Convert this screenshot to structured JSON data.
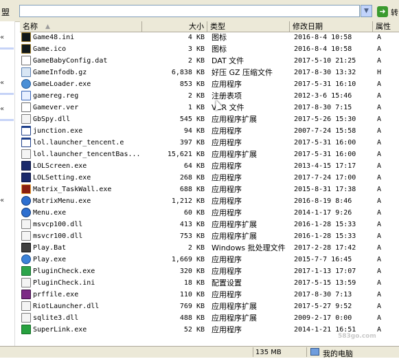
{
  "address_bar": {
    "left_text": "盟",
    "dropdown_icon": "chevron-down-icon",
    "go_label": "转"
  },
  "columns": {
    "name": "名称",
    "size": "大小",
    "type": "类型",
    "date": "修改日期",
    "attr": "属性"
  },
  "files": [
    {
      "name": "Game48.ini",
      "size": "4 KB",
      "type": "图标",
      "date": "2016-8-4 10:58",
      "attr": "A",
      "icon": "game-icon"
    },
    {
      "name": "Game.ico",
      "size": "3 KB",
      "type": "图标",
      "date": "2016-8-4 10:58",
      "attr": "A",
      "icon": "game-icon"
    },
    {
      "name": "GameBabyConfig.dat",
      "size": "2 KB",
      "type": "DAT 文件",
      "date": "2017-5-10 21:25",
      "attr": "A",
      "icon": "document-icon"
    },
    {
      "name": "GameInfodb.gz",
      "size": "6,838 KB",
      "type": "好压 GZ 压缩文件",
      "date": "2017-8-30 13:32",
      "attr": "H",
      "icon": "archive-icon"
    },
    {
      "name": "GameLoader.exe",
      "size": "853 KB",
      "type": "应用程序",
      "date": "2017-5-31 16:10",
      "attr": "A",
      "icon": "loader-icon"
    },
    {
      "name": "gamereg.reg",
      "size": "2 KB",
      "type": "注册表项",
      "date": "2012-3-6 15:46",
      "attr": "A",
      "icon": "registry-icon"
    },
    {
      "name": "Gamever.ver",
      "size": "1 KB",
      "type": "VER 文件",
      "date": "2017-8-30 7:15",
      "attr": "A",
      "icon": "document-icon"
    },
    {
      "name": "GbSpy.dll",
      "size": "545 KB",
      "type": "应用程序扩展",
      "date": "2017-5-26 15:30",
      "attr": "A",
      "icon": "dll-icon"
    },
    {
      "name": "junction.exe",
      "size": "94 KB",
      "type": "应用程序",
      "date": "2007-7-24 15:58",
      "attr": "A",
      "icon": "app-icon"
    },
    {
      "name": "lol.launcher_tencent.e",
      "size": "397 KB",
      "type": "应用程序",
      "date": "2017-5-31 16:00",
      "attr": "A",
      "icon": "app-icon"
    },
    {
      "name": "lol.launcher_tencentBas...",
      "size": "15,621 KB",
      "type": "应用程序扩展",
      "date": "2017-5-31 16:00",
      "attr": "A",
      "icon": "dll-icon"
    },
    {
      "name": "LOLScreen.exe",
      "size": "64 KB",
      "type": "应用程序",
      "date": "2013-4-15 17:17",
      "attr": "A",
      "icon": "lol-screen-icon"
    },
    {
      "name": "LOLSetting.exe",
      "size": "268 KB",
      "type": "应用程序",
      "date": "2017-7-24 17:00",
      "attr": "A",
      "icon": "lol-setting-icon"
    },
    {
      "name": "Matrix_TaskWall.exe",
      "size": "688 KB",
      "type": "应用程序",
      "date": "2015-8-31 17:38",
      "attr": "A",
      "icon": "matrix-icon"
    },
    {
      "name": "MatrixMenu.exe",
      "size": "1,212 KB",
      "type": "应用程序",
      "date": "2016-8-19 8:46",
      "attr": "A",
      "icon": "menu-icon"
    },
    {
      "name": "Menu.exe",
      "size": "60 KB",
      "type": "应用程序",
      "date": "2014-1-17 9:26",
      "attr": "A",
      "icon": "menu-icon"
    },
    {
      "name": "msvcp100.dll",
      "size": "413 KB",
      "type": "应用程序扩展",
      "date": "2016-1-28 15:33",
      "attr": "A",
      "icon": "dll-icon"
    },
    {
      "name": "msvcr100.dll",
      "size": "753 KB",
      "type": "应用程序扩展",
      "date": "2016-1-28 15:33",
      "attr": "A",
      "icon": "dll-icon"
    },
    {
      "name": "Play.Bat",
      "size": "2 KB",
      "type": "Windows 批处理文件",
      "date": "2017-2-28 17:42",
      "attr": "A",
      "icon": "batch-icon"
    },
    {
      "name": "Play.exe",
      "size": "1,669 KB",
      "type": "应用程序",
      "date": "2015-7-7 16:45",
      "attr": "A",
      "icon": "play-icon"
    },
    {
      "name": "PluginCheck.exe",
      "size": "320 KB",
      "type": "应用程序",
      "date": "2017-1-13 17:07",
      "attr": "A",
      "icon": "puzzle-icon"
    },
    {
      "name": "PluginCheck.ini",
      "size": "18 KB",
      "type": "配置设置",
      "date": "2017-5-15 13:59",
      "attr": "A",
      "icon": "config-icon"
    },
    {
      "name": "prffile.exe",
      "size": "110 KB",
      "type": "应用程序",
      "date": "2017-8-30 7:13",
      "attr": "A",
      "icon": "rar-icon"
    },
    {
      "name": "RiotLauncher.dll",
      "size": "769 KB",
      "type": "应用程序扩展",
      "date": "2017-5-27 9:52",
      "attr": "A",
      "icon": "dll-icon"
    },
    {
      "name": "sqlite3.dll",
      "size": "488 KB",
      "type": "应用程序扩展",
      "date": "2009-2-17 0:00",
      "attr": "A",
      "icon": "dll-icon"
    },
    {
      "name": "SuperLink.exe",
      "size": "52 KB",
      "type": "应用程序",
      "date": "2014-1-21 16:51",
      "attr": "A",
      "icon": "superlink-icon"
    }
  ],
  "status_bar": {
    "size_text": "135 MB",
    "computer_label": "我的电脑",
    "computer_icon": "my-computer-icon"
  },
  "watermark": "583go.com"
}
